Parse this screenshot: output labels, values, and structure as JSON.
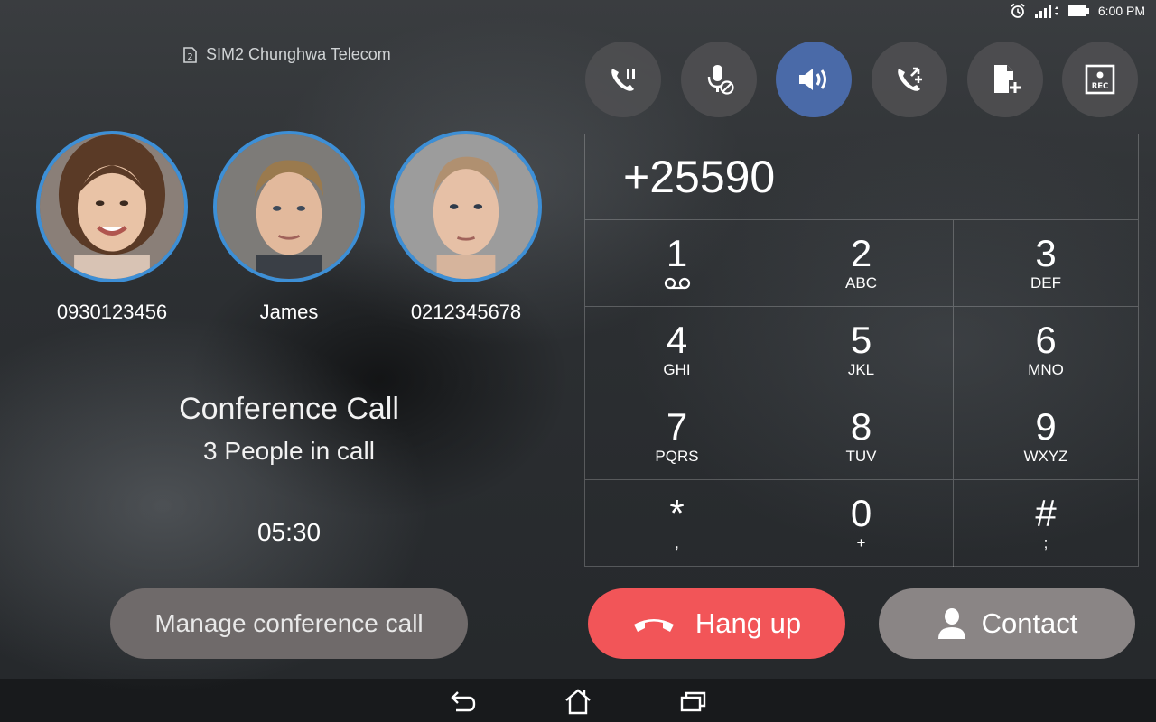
{
  "status_bar": {
    "time": "6:00 PM",
    "icons": [
      "alarm-icon",
      "signal-icon",
      "battery-icon"
    ]
  },
  "sim": {
    "badge": "2",
    "label": "SIM2 Chunghwa Telecom"
  },
  "participants": [
    {
      "name": "0930123456"
    },
    {
      "name": "James"
    },
    {
      "name": "0212345678"
    }
  ],
  "conference": {
    "title": "Conference Call",
    "subtitle": "3 People in call",
    "timer": "05:30"
  },
  "manage_label": "Manage conference call",
  "actions": [
    {
      "icon": "hold-call-icon",
      "active": false
    },
    {
      "icon": "mute-mic-icon",
      "active": false
    },
    {
      "icon": "speaker-icon",
      "active": true
    },
    {
      "icon": "add-call-icon",
      "active": false
    },
    {
      "icon": "note-add-icon",
      "active": false
    },
    {
      "icon": "record-icon",
      "active": false,
      "label": "REC"
    }
  ],
  "dialpad": {
    "display": "+25590",
    "keys": [
      {
        "digit": "1",
        "letters": ""
      },
      {
        "digit": "2",
        "letters": "ABC"
      },
      {
        "digit": "3",
        "letters": "DEF"
      },
      {
        "digit": "4",
        "letters": "GHI"
      },
      {
        "digit": "5",
        "letters": "JKL"
      },
      {
        "digit": "6",
        "letters": "MNO"
      },
      {
        "digit": "7",
        "letters": "PQRS"
      },
      {
        "digit": "8",
        "letters": "TUV"
      },
      {
        "digit": "9",
        "letters": "WXYZ"
      },
      {
        "digit": "*",
        "letters": ","
      },
      {
        "digit": "0",
        "letters": "+"
      },
      {
        "digit": "#",
        "letters": ";"
      }
    ]
  },
  "hangup_label": "Hang up",
  "contact_label": "Contact",
  "colors": {
    "accent": "#3d8fd6",
    "hangup": "#f25558",
    "speaker_active": "#4a6aa8"
  }
}
